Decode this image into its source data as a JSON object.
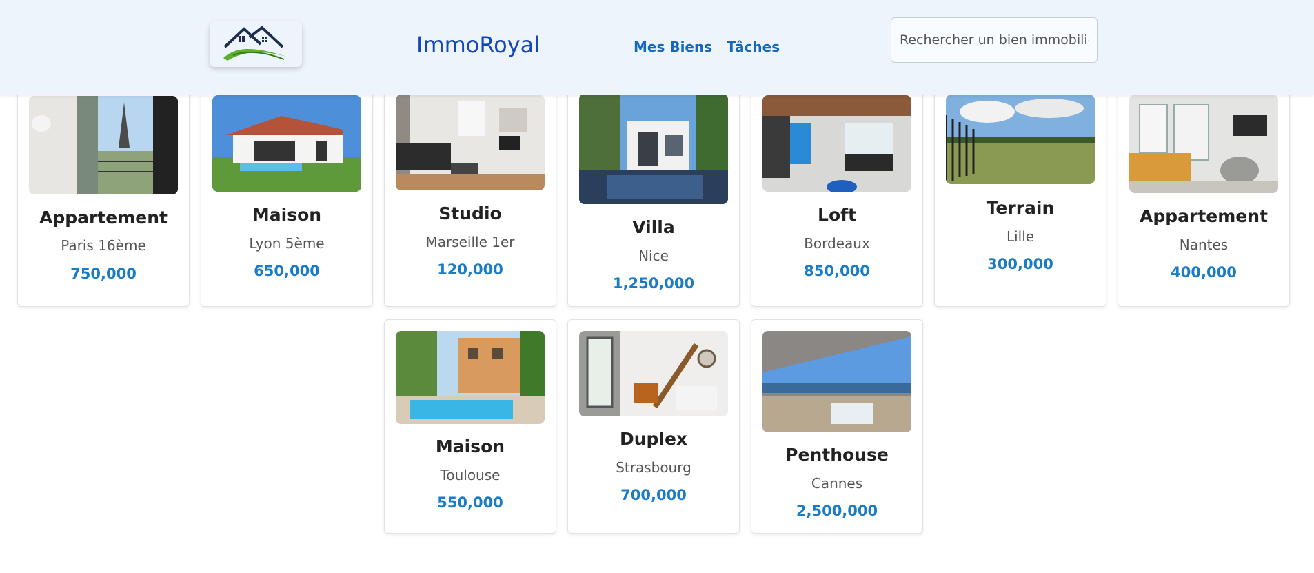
{
  "header": {
    "brand": "ImmoRoyal",
    "nav": {
      "biens": "Mes Biens",
      "taches": "Tâches"
    },
    "search_placeholder": "Rechercher un bien immobilier..."
  },
  "properties": [
    {
      "title": "Appartement",
      "location": "Paris 16ème",
      "price": "750,000",
      "image": "paris-balcony-photo"
    },
    {
      "title": "Maison",
      "location": "Lyon 5ème",
      "price": "650,000",
      "image": "house-pool-photo"
    },
    {
      "title": "Studio",
      "location": "Marseille 1er",
      "price": "120,000",
      "image": "studio-interior-photo"
    },
    {
      "title": "Villa",
      "location": "Nice",
      "price": "1,250,000",
      "image": "villa-pool-photo"
    },
    {
      "title": "Loft",
      "location": "Bordeaux",
      "price": "850,000",
      "image": "loft-interior-photo"
    },
    {
      "title": "Terrain",
      "location": "Lille",
      "price": "300,000",
      "image": "field-photo"
    },
    {
      "title": "Appartement",
      "location": "Nantes",
      "price": "400,000",
      "image": "living-room-photo"
    },
    {
      "title": "Maison",
      "location": "Toulouse",
      "price": "550,000",
      "image": "house-pool-garden-photo"
    },
    {
      "title": "Duplex",
      "location": "Strasbourg",
      "price": "700,000",
      "image": "duplex-staircase-photo"
    },
    {
      "title": "Penthouse",
      "location": "Cannes",
      "price": "2,500,000",
      "image": "penthouse-terrace-photo"
    }
  ]
}
